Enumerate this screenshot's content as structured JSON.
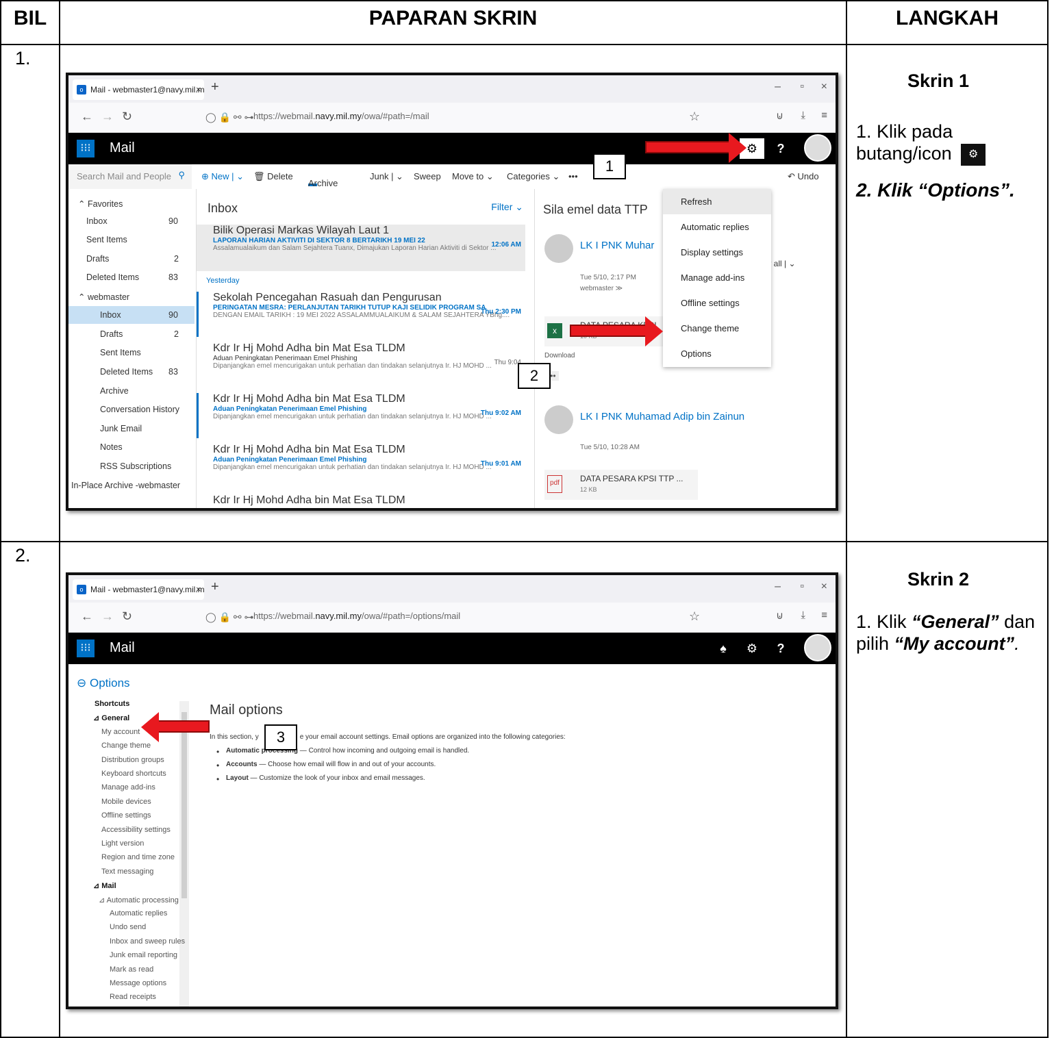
{
  "header": {
    "bil": "BIL",
    "screen": "PAPARAN SKRIN",
    "step": "LANGKAH"
  },
  "rows": [
    {
      "bil": "1.",
      "skrin": "Skrin 1",
      "step1": "1. Klik pada butang/icon",
      "step2": "2. Klik “Options”."
    },
    {
      "bil": "2.",
      "skrin": "Skrin 2",
      "step_a": "1. Klik ",
      "general": "“General”",
      "step_b": " dan pilih ",
      "myacc": "“My account”",
      "step_c": "."
    }
  ],
  "browser": {
    "tab_title": "Mail - webmaster1@navy.mil.m",
    "url1_pre": "https://webmail.",
    "url1_host": "navy.mil.my",
    "url1_post": "/owa/#path=/mail",
    "url2_pre": "https://webmail.",
    "url2_host": "navy.mil.my",
    "url2_post": "/owa/#path=/options/mail",
    "app_title": "Mail"
  },
  "screen1": {
    "search_placeholder": "Search Mail and People",
    "commands": [
      "⊕ New | ⌄",
      "🗑 Delete",
      "Archive",
      "Junk | ⌄",
      "Sweep",
      "Move to ⌄",
      "Categories ⌄",
      "•••",
      "↶ Undo"
    ],
    "folders": [
      {
        "label": "⌃ Favorites",
        "count": ""
      },
      {
        "label": "Inbox",
        "count": "90"
      },
      {
        "label": "Sent Items",
        "count": ""
      },
      {
        "label": "Drafts",
        "count": "2"
      },
      {
        "label": "Deleted Items",
        "count": "83"
      },
      {
        "label": "⌃ webmaster",
        "count": ""
      },
      {
        "label": "Inbox",
        "count": "90"
      },
      {
        "label": "Drafts",
        "count": "2"
      },
      {
        "label": "Sent Items",
        "count": ""
      },
      {
        "label": "Deleted Items",
        "count": "83"
      },
      {
        "label": "Archive",
        "count": ""
      },
      {
        "label": "Conversation History",
        "count": ""
      },
      {
        "label": "Junk Email",
        "count": ""
      },
      {
        "label": "Notes",
        "count": ""
      },
      {
        "label": "RSS Subscriptions",
        "count": ""
      },
      {
        "label": "In-Place Archive -webmaster",
        "count": ""
      }
    ],
    "inbox_title": "Inbox",
    "filter": "Filter ⌄",
    "yesterday": "Yesterday",
    "messages": [
      {
        "from": "Bilik Operasi Markas Wilayah Laut 1",
        "subject": "LAPORAN HARIAN AKTIVITI DI SEKTOR 8 BERTARIKH 19 MEI 22",
        "preview": "Assalamualaikum dan Salam Sejahtera Tuanx, Dimajukan Laporan Harian Aktiviti di Sektor ...",
        "time": "12:06 AM"
      },
      {
        "from": "Sekolah Pencegahan Rasuah dan Pengurusan",
        "subject": "PERINGATAN MESRA: PERLANJUTAN TARIKH TUTUP KAJI SELIDIK PROGRAM SA",
        "preview": "DENGAN EMAIL TARIKH : 19 MEI 2022 ASSALAMMUALAIKUM & SALAM SEJAHTERA YBhg....",
        "time": "Thu 2:30 PM"
      },
      {
        "from": "Kdr Ir Hj Mohd Adha bin Mat Esa TLDM",
        "subject": "Aduan Peningkatan Penerimaan Emel Phishing",
        "preview": "Dipanjangkan emel mencurigakan untuk perhatian dan tindakan selanjutnya Ir. HJ MOHD ...",
        "time": "Thu 9:04"
      },
      {
        "from": "Kdr Ir Hj Mohd Adha bin Mat Esa TLDM",
        "subject": "Aduan Peningkatan Penerimaan Emel Phishing",
        "preview": "Dipanjangkan emel mencurigakan untuk perhatian dan tindakan selanjutnya Ir. HJ MOHD ...",
        "time": "Thu 9:02 AM"
      },
      {
        "from": "Kdr Ir Hj Mohd Adha bin Mat Esa TLDM",
        "subject": "Aduan Peningkatan Penerimaan Emel Phishing",
        "preview": "Dipanjangkan emel mencurigakan untuk perhatian dan tindakan selanjutnya Ir. HJ MOHD ...",
        "time": "Thu 9:01 AM"
      },
      {
        "from": "Kdr Ir Hj Mohd Adha bin Mat Esa TLDM",
        "subject": "",
        "preview": "",
        "time": ""
      }
    ],
    "reading": {
      "subject": "Sila emel data TTP",
      "sender1": "LK I PNK Muhar",
      "date1": "Tue 5/10, 2:17 PM",
      "to1": "webmaster ≫",
      "reply_all": "ply all | ⌄",
      "attachment1": "DATA PESARA KPSI",
      "attachment1_size": "10 KB",
      "download": "Download",
      "more": "•••",
      "sender2": "LK I PNK Muhamad Adip bin Zainun",
      "date2": "Tue 5/10, 10:28 AM",
      "attachment2": "DATA PESARA KPSI TTP ...",
      "attachment2_size": "12 KB",
      "pdf": "pdf"
    },
    "menu": [
      "Refresh",
      "Automatic replies",
      "Display settings",
      "Manage add-ins",
      "Offline settings",
      "Change theme",
      "Options"
    ],
    "callout1": "1",
    "callout2": "2"
  },
  "screen2": {
    "options_link": "⊖ Options",
    "page_title": "Mail options",
    "intro_a": "In this section, y",
    "intro_b": "e your email account settings. Email options are organized into the following categories:",
    "bullets": [
      {
        "b": "Automatic processing",
        "t": " — Control how incoming and outgoing email is handled."
      },
      {
        "b": "Accounts",
        "t": " — Choose how email will flow in and out of your accounts."
      },
      {
        "b": "Layout",
        "t": " — Customize the look of your inbox and email messages."
      }
    ],
    "nav": [
      {
        "label": "Shortcuts",
        "level": "h"
      },
      {
        "label": "⊿ General",
        "level": "h"
      },
      {
        "label": "My account",
        "level": "1"
      },
      {
        "label": "Change theme",
        "level": "1"
      },
      {
        "label": "Distribution groups",
        "level": "1"
      },
      {
        "label": "Keyboard shortcuts",
        "level": "1"
      },
      {
        "label": "Manage add-ins",
        "level": "1"
      },
      {
        "label": "Mobile devices",
        "level": "1"
      },
      {
        "label": "Offline settings",
        "level": "1"
      },
      {
        "label": "Accessibility settings",
        "level": "1"
      },
      {
        "label": "Light version",
        "level": "1"
      },
      {
        "label": "Region and time zone",
        "level": "1"
      },
      {
        "label": "Text messaging",
        "level": "1"
      },
      {
        "label": "⊿ Mail",
        "level": "h"
      },
      {
        "label": "⊿ Automatic processing",
        "level": "1"
      },
      {
        "label": "Automatic replies",
        "level": "2"
      },
      {
        "label": "Undo send",
        "level": "2"
      },
      {
        "label": "Inbox and sweep rules",
        "level": "2"
      },
      {
        "label": "Junk email reporting",
        "level": "2"
      },
      {
        "label": "Mark as read",
        "level": "2"
      },
      {
        "label": "Message options",
        "level": "2"
      },
      {
        "label": "Read receipts",
        "level": "2"
      }
    ],
    "callout3": "3"
  }
}
